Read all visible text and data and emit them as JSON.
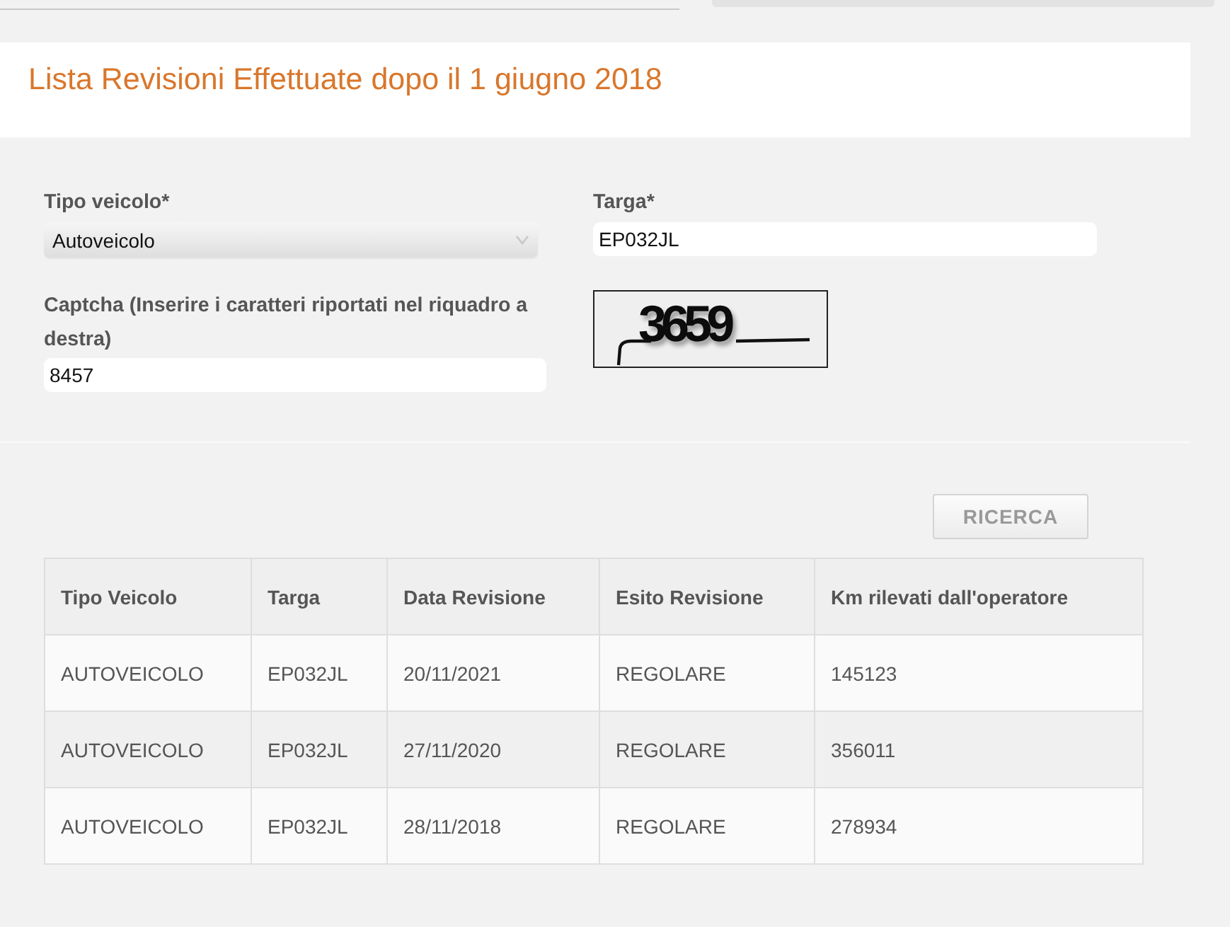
{
  "title": "Lista Revisioni Effettuate dopo il 1 giugno 2018",
  "form": {
    "vehicle_type": {
      "label": "Tipo veicolo*",
      "value": "Autoveicolo"
    },
    "plate": {
      "label": "Targa*",
      "value": "EP032JL"
    },
    "captcha": {
      "label": "Captcha (Inserire i caratteri riportati nel riquadro a destra)",
      "value": "8457"
    },
    "captcha_image": {
      "text": "3659"
    }
  },
  "search_button": "RICERCA",
  "table": {
    "columns": [
      "Tipo Veicolo",
      "Targa",
      "Data Revisione",
      "Esito Revisione",
      "Km rilevati dall'operatore"
    ],
    "rows": [
      [
        "AUTOVEICOLO",
        "EP032JL",
        "20/11/2021",
        "REGOLARE",
        "145123"
      ],
      [
        "AUTOVEICOLO",
        "EP032JL",
        "27/11/2020",
        "REGOLARE",
        "356011"
      ],
      [
        "AUTOVEICOLO",
        "EP032JL",
        "28/11/2018",
        "REGOLARE",
        "278934"
      ]
    ]
  }
}
